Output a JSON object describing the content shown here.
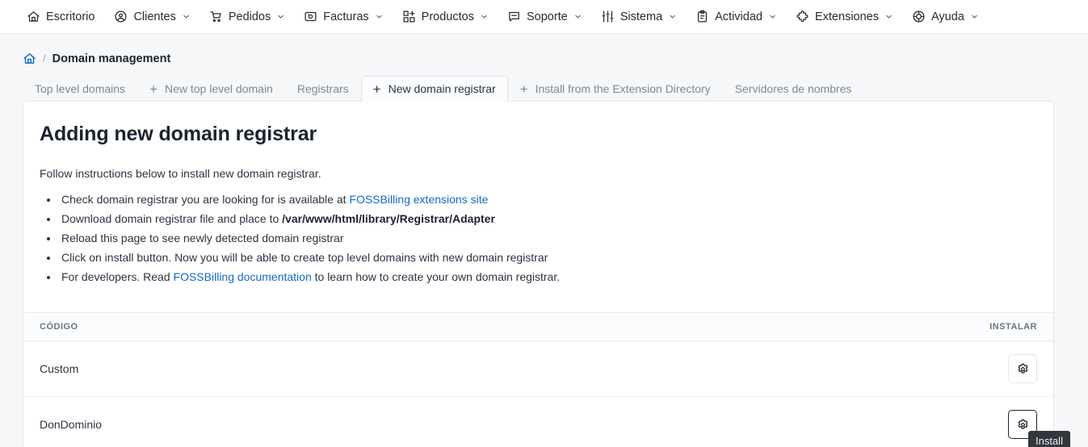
{
  "topnav": {
    "items": [
      {
        "label": "Escritorio",
        "icon": "home-icon",
        "caret": false
      },
      {
        "label": "Clientes",
        "icon": "user-circle-icon",
        "caret": true
      },
      {
        "label": "Pedidos",
        "icon": "shopping-cart-icon",
        "caret": true
      },
      {
        "label": "Facturas",
        "icon": "receipt-icon",
        "caret": true
      },
      {
        "label": "Productos",
        "icon": "grid-plus-icon",
        "caret": true
      },
      {
        "label": "Soporte",
        "icon": "message-icon",
        "caret": true
      },
      {
        "label": "Sistema",
        "icon": "sliders-icon",
        "caret": true
      },
      {
        "label": "Actividad",
        "icon": "clipboard-icon",
        "caret": true
      },
      {
        "label": "Extensiones",
        "icon": "puzzle-icon",
        "caret": true
      },
      {
        "label": "Ayuda",
        "icon": "lifebuoy-icon",
        "caret": true
      }
    ]
  },
  "breadcrumb": {
    "home_icon": "home-icon",
    "separator": "/",
    "current": "Domain management"
  },
  "tabs": [
    {
      "label": "Top level domains",
      "plus": false,
      "active": false
    },
    {
      "label": "New top level domain",
      "plus": true,
      "active": false
    },
    {
      "label": "Registrars",
      "plus": false,
      "active": false
    },
    {
      "label": "New domain registrar",
      "plus": true,
      "active": true
    },
    {
      "label": "Install from the Extension Directory",
      "plus": true,
      "active": false
    },
    {
      "label": "Servidores de nombres",
      "plus": false,
      "active": false
    }
  ],
  "page": {
    "title": "Adding new domain registrar",
    "lead": "Follow instructions below to install new domain registrar.",
    "instructions": [
      {
        "parts": [
          {
            "type": "text",
            "text": "Check domain registrar you are looking for is available at "
          },
          {
            "type": "link",
            "text": "FOSSBilling extensions site"
          }
        ]
      },
      {
        "parts": [
          {
            "type": "text",
            "text": "Download domain registrar file and place to "
          },
          {
            "type": "bold",
            "text": "/var/www/html/library/Registrar/Adapter"
          }
        ]
      },
      {
        "parts": [
          {
            "type": "text",
            "text": "Reload this page to see newly detected domain registrar"
          }
        ]
      },
      {
        "parts": [
          {
            "type": "text",
            "text": "Click on install button. Now you will be able to create top level domains with new domain registrar"
          }
        ]
      },
      {
        "parts": [
          {
            "type": "text",
            "text": "For developers. Read "
          },
          {
            "type": "link",
            "text": "FOSSBilling documentation"
          },
          {
            "type": "text",
            "text": " to learn how to create your own domain registrar."
          }
        ]
      }
    ]
  },
  "table": {
    "columns": [
      "CÓDIGO",
      "INSTALAR"
    ],
    "rows": [
      {
        "code": "Custom",
        "action_icon": "gear-icon",
        "focused": false
      },
      {
        "code": "DonDominio",
        "action_icon": "gear-icon",
        "focused": true
      }
    ]
  },
  "tooltip": {
    "text": "Install",
    "background": "#32373d",
    "color": "#e9ecef"
  },
  "colors": {
    "page_background": "#f6f7f9",
    "card_background": "#ffffff",
    "link": "#1668c4",
    "text": "#2b3443",
    "muted": "#7d879c"
  }
}
